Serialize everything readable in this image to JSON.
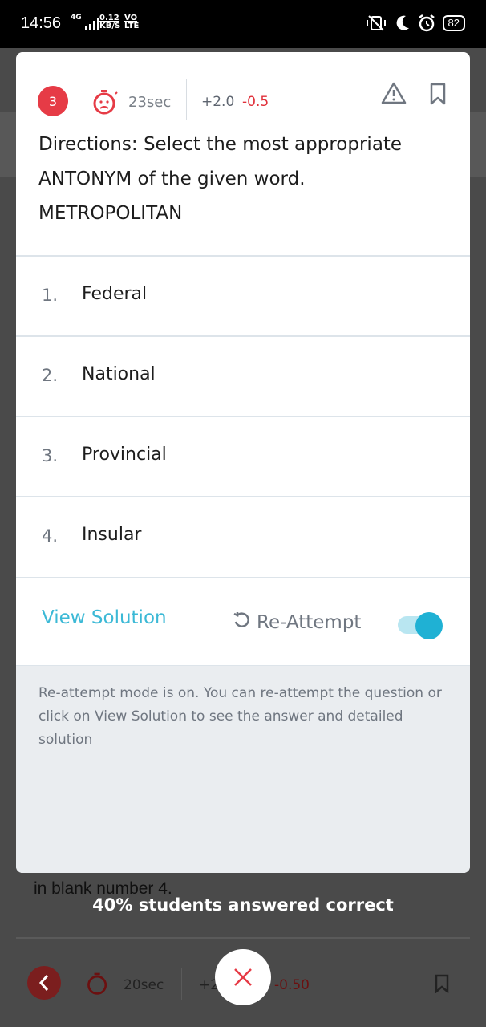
{
  "status_bar": {
    "time": "14:56",
    "network": "4G",
    "speed": "0.12",
    "speed_unit": "KB/S",
    "volte_top": "VO",
    "volte_bottom": "LTE",
    "battery": "82"
  },
  "question_card": {
    "question_number": "3",
    "timer": "23sec",
    "marks_positive": "+2.0",
    "marks_negative": "-0.5",
    "directions": "Directions: Select the most appropriate ANTONYM of the given word.",
    "word": "METROPOLITAN",
    "options": [
      {
        "num": "1.",
        "label": "Federal"
      },
      {
        "num": "2.",
        "label": "National"
      },
      {
        "num": "3.",
        "label": "Provincial"
      },
      {
        "num": "4.",
        "label": "Insular"
      }
    ],
    "view_solution_label": "View Solution",
    "reattempt_label": "Re-Attempt",
    "reattempt_on": true,
    "info_text": "Re-attempt mode is on. You can re-attempt the question or click on View Solution to see the answer and detailed solution"
  },
  "background": {
    "partial_text": "in blank number 4.",
    "stat_text": "40% students answered correct",
    "timer": "20sec",
    "marks_positive": "+2",
    "marks_negative": "-0.50"
  },
  "colors": {
    "accent": "#1fb1d4",
    "question_badge": "#e63b46",
    "negative": "#e0303a"
  }
}
